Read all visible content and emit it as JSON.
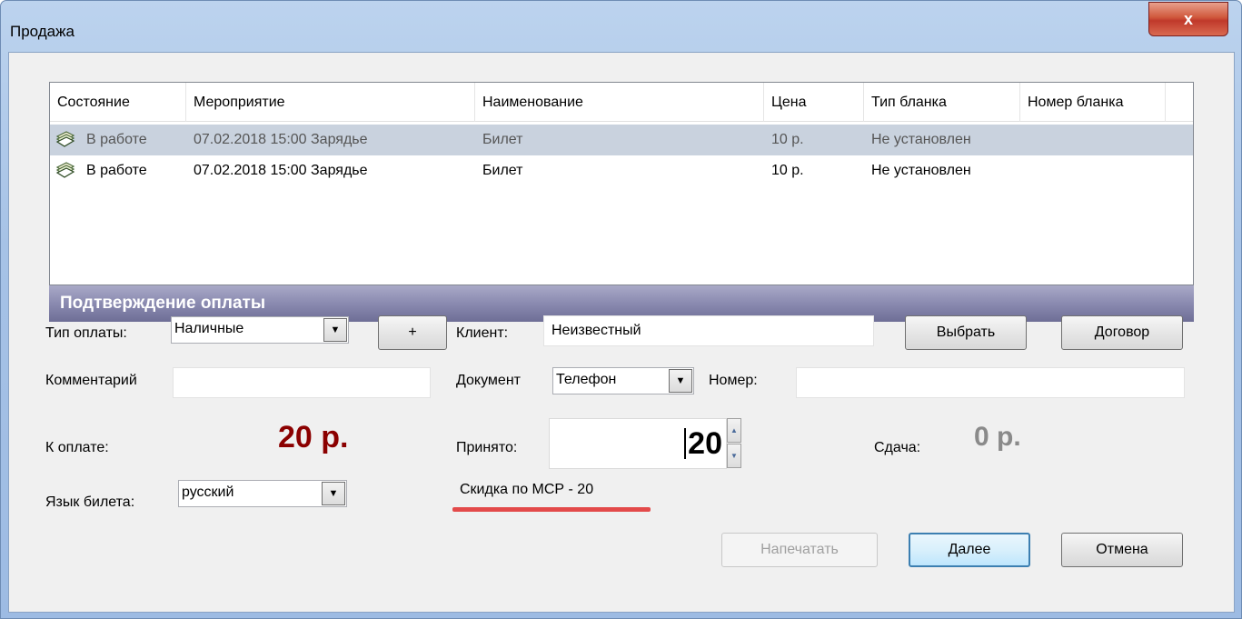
{
  "window": {
    "title": "Продажа",
    "close_label": "x"
  },
  "table": {
    "columns": [
      "Состояние",
      "Мероприятие",
      "Наименование",
      "Цена",
      "Тип бланка",
      "Номер бланка"
    ],
    "rows": [
      {
        "state": "В работе",
        "event": "07.02.2018 15:00 Зарядье",
        "name": "Билет",
        "price": "10 р.",
        "blank_type": "Не установлен",
        "blank_number": ""
      },
      {
        "state": "В работе",
        "event": "07.02.2018 15:00 Зарядье",
        "name": "Билет",
        "price": "10 р.",
        "blank_type": "Не установлен",
        "blank_number": ""
      }
    ]
  },
  "payment": {
    "section_title": "Подтверждение оплаты",
    "payment_type_label": "Тип оплаты:",
    "payment_type_value": "Наличные",
    "add_label": "+",
    "client_label": "Клиент:",
    "client_value": "Неизвестный",
    "choose_label": "Выбрать",
    "contract_label": "Договор",
    "comment_label": "Комментарий",
    "comment_value": "",
    "document_label": "Документ",
    "document_value": "Телефон",
    "number_label": "Номер:",
    "number_value": "",
    "to_pay_label": "К оплате:",
    "to_pay_value": "20 р.",
    "accepted_label": "Принято:",
    "accepted_value": "20",
    "change_label": "Сдача:",
    "change_value": "0 р.",
    "ticket_lang_label": "Язык билета:",
    "ticket_lang_value": "русский",
    "discount_note": "Скидка по МСР - 20"
  },
  "buttons": {
    "print": "Напечатать",
    "next": "Далее",
    "cancel": "Отмена"
  },
  "colors": {
    "amount_due": "#8b0000",
    "change": "#8a8a8a",
    "section_bar": "#8a8ab0",
    "discount_underline": "#e34a4a"
  }
}
